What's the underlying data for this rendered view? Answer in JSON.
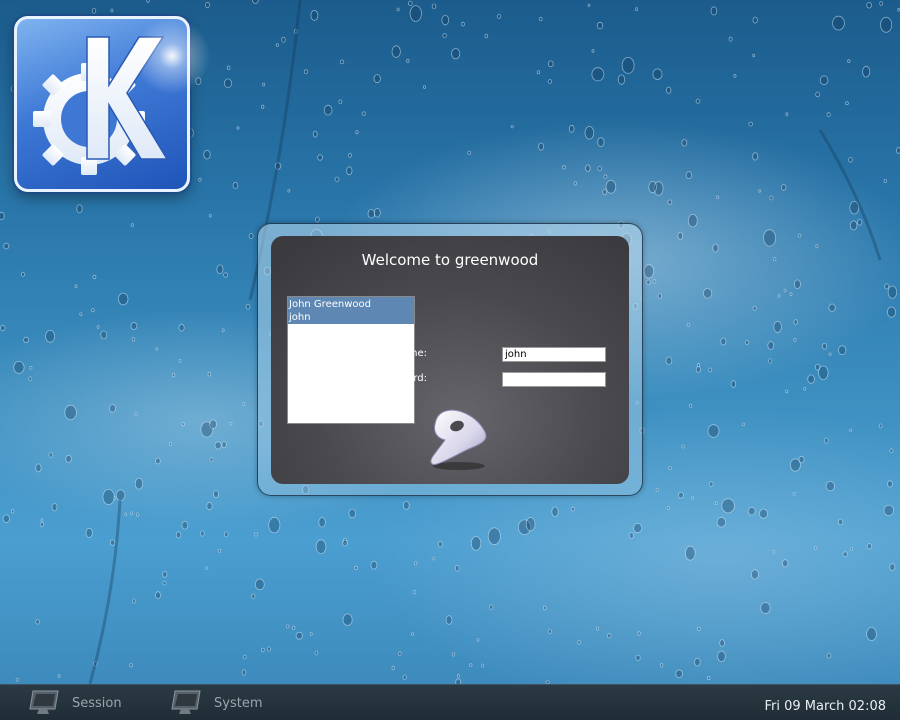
{
  "login": {
    "welcome": "Welcome to greenwood",
    "users": [
      {
        "label": "John Greenwood"
      },
      {
        "label": "john"
      }
    ],
    "username_label": "Username:",
    "username_value": "john",
    "password_label": "Password:",
    "password_value": ""
  },
  "taskbar": {
    "session_label": "Session",
    "system_label": "System",
    "clock": "Fri 09 March 02:08"
  },
  "colors": {
    "selection": "#5e87b3",
    "panel": "#4a494e",
    "taskbar": "#1f2c35"
  },
  "icons": [
    "kde-logo",
    "gentoo-logo",
    "monitor-icon"
  ]
}
